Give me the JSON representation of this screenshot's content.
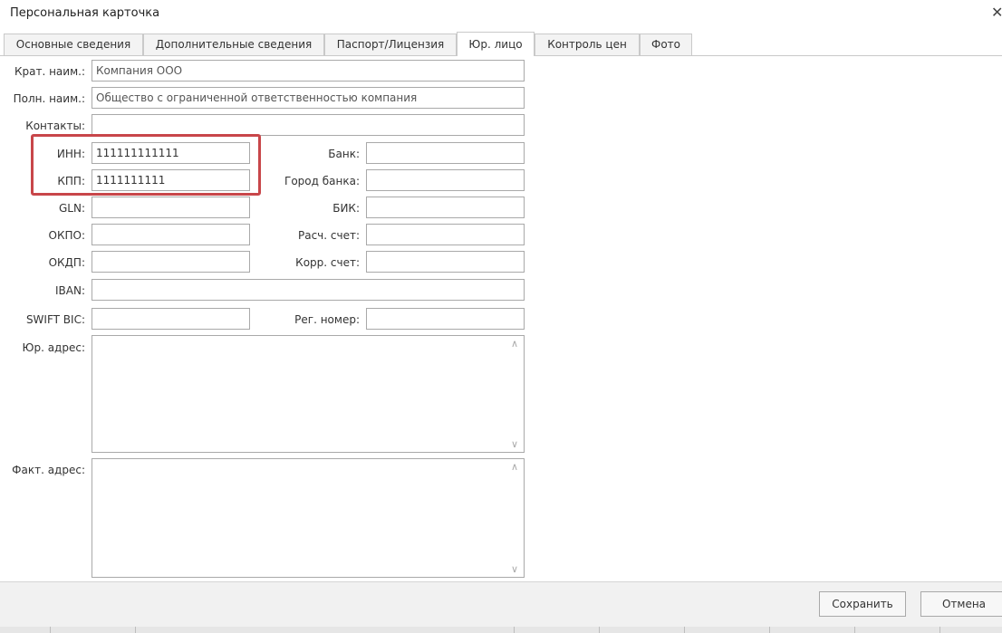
{
  "window": {
    "title": "Персональная карточка",
    "close_glyph": "✕"
  },
  "tabs": [
    {
      "label": "Основные сведения",
      "active": false
    },
    {
      "label": "Дополнительные сведения",
      "active": false
    },
    {
      "label": "Паспорт/Лицензия",
      "active": false
    },
    {
      "label": "Юр. лицо",
      "active": true
    },
    {
      "label": "Контроль цен",
      "active": false
    },
    {
      "label": "Фото",
      "active": false
    }
  ],
  "form": {
    "short_name": {
      "label": "Крат. наим.:",
      "value": "Компания ООО"
    },
    "full_name": {
      "label": "Полн. наим.:",
      "value": "Общество с ограниченной ответственностью компания"
    },
    "contacts": {
      "label": "Контакты:",
      "value": ""
    },
    "inn": {
      "label": "ИНН:",
      "value": "111111111111"
    },
    "kpp": {
      "label": "КПП:",
      "value": "1111111111"
    },
    "gln": {
      "label": "GLN:",
      "value": ""
    },
    "okpo": {
      "label": "ОКПО:",
      "value": ""
    },
    "okdp": {
      "label": "ОКДП:",
      "value": ""
    },
    "iban": {
      "label": "IBAN:",
      "value": ""
    },
    "swift": {
      "label": "SWIFT BIC:",
      "value": ""
    },
    "bank": {
      "label": "Банк:",
      "value": ""
    },
    "bank_city": {
      "label": "Город банка:",
      "value": ""
    },
    "bik": {
      "label": "БИК:",
      "value": ""
    },
    "account": {
      "label": "Расч. счет:",
      "value": ""
    },
    "corr_account": {
      "label": "Корр. счет:",
      "value": ""
    },
    "reg_number": {
      "label": "Рег. номер:",
      "value": ""
    },
    "legal_address": {
      "label": "Юр. адрес:",
      "value": ""
    },
    "actual_address": {
      "label": "Факт. адрес:",
      "value": ""
    }
  },
  "footer": {
    "save_label": "Сохранить",
    "cancel_label": "Отмена"
  },
  "colors": {
    "highlight": "#c8464a"
  }
}
